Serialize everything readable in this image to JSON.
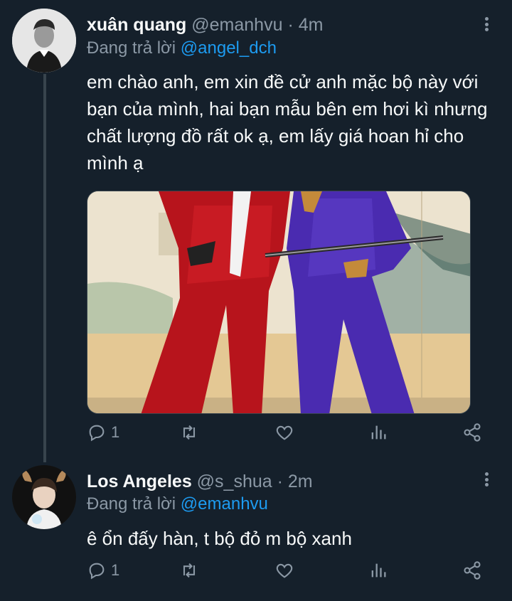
{
  "tweets": [
    {
      "display_name": "xuân quang",
      "handle": "@emanhvu",
      "time": "· 4m",
      "replying_prefix": "Đang trả lời",
      "replying_to": "@angel_dch",
      "text": "em chào anh, em xin đề cử anh mặc bộ này với bạn của mình, hai bạn mẫu bên em hơi kì nhưng chất lượng đồ rất ok ạ, em lấy giá hoan hỉ cho mình ạ",
      "reply_count": "1",
      "avatar_icon": "person-avatar-grayscale"
    },
    {
      "display_name": "Los Angeles",
      "handle": "@s_shua",
      "time": "· 2m",
      "replying_prefix": "Đang trả lời",
      "replying_to": "@emanhvu",
      "text": "ê ổn đấy hàn, t bộ đỏ m bộ xanh",
      "reply_count": "1",
      "avatar_icon": "person-avatar-deer-ears"
    }
  ],
  "colors": {
    "background": "#15202b",
    "text": "#f7f9f9",
    "secondary": "#8b98a5",
    "link": "#1d9bf0",
    "divider": "#38444d"
  },
  "icons": [
    "reply-icon",
    "retweet-icon",
    "like-icon",
    "analytics-icon",
    "share-icon",
    "more-icon"
  ]
}
